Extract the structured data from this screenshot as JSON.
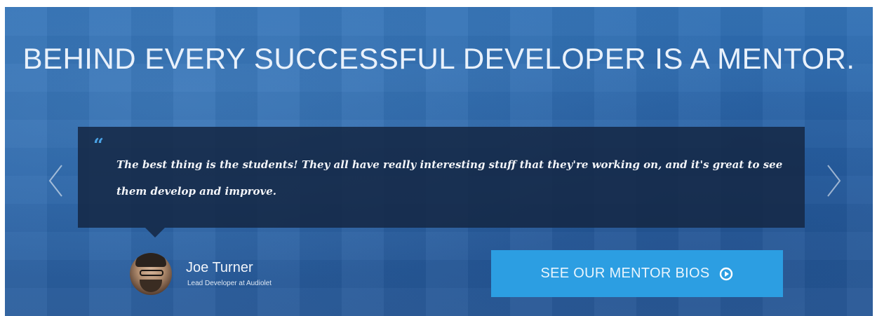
{
  "hero": {
    "headline": "BEHIND EVERY SUCCESSFUL DEVELOPER IS A MENTOR."
  },
  "testimonial": {
    "quote_mark": "“",
    "text": "The best thing is the students! They all have really interesting stuff that they're working on, and it's great to see them develop and improve.",
    "author_name": "Joe Turner",
    "author_title": "Lead Developer at Audiolet"
  },
  "carousel": {
    "prev_icon": "chevron-left-icon",
    "next_icon": "chevron-right-icon"
  },
  "cta": {
    "label": "SEE OUR MENTOR BIOS",
    "icon": "play-circle-icon"
  },
  "colors": {
    "background": "#2a64a8",
    "quote_box": "#142846",
    "cta_button": "#2c9ee2",
    "quote_mark": "#4aa3e6"
  }
}
